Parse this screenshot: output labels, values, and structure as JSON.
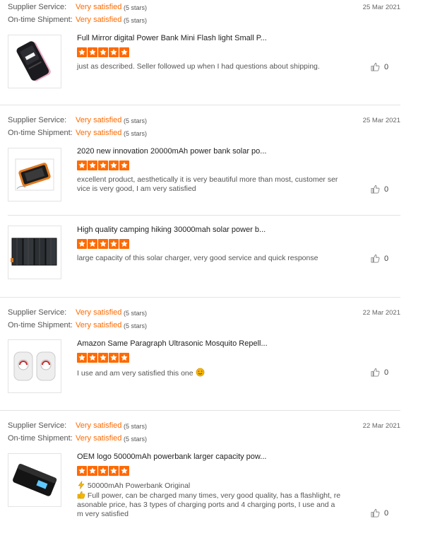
{
  "labels": {
    "supplier_service": "Supplier Service:",
    "ontime_shipment": "On-time Shipment:"
  },
  "colors": {
    "accent": "#ff6a00",
    "divider": "#e3e3e3"
  },
  "reviews": [
    {
      "supplier_value": "Very satisfied",
      "supplier_stars_text": "(5 stars)",
      "shipment_value": "Very satisfied",
      "shipment_stars_text": "(5 stars)",
      "date": "25 Mar 2021",
      "products": [
        {
          "title": "Full Mirror digital Power Bank Mini Flash light Small P...",
          "rating": 5,
          "review": "just as described. Seller followed up when I had questions about shipping.",
          "likes": "0",
          "image": "power-bank-mirror-image"
        }
      ]
    },
    {
      "supplier_value": "Very satisfied",
      "supplier_stars_text": "(5 stars)",
      "shipment_value": "Very satisfied",
      "shipment_stars_text": "(5 stars)",
      "date": "25 Mar 2021",
      "products": [
        {
          "title": "2020 new innovation 20000mAh power bank solar po...",
          "rating": 5,
          "review": "excellent product, aesthetically it is very beautiful more than most, customer service is very good, I am very satisfied",
          "likes": "0",
          "image": "solar-power-bank-image"
        },
        {
          "title": "High quality camping hiking 30000mah solar power b...",
          "rating": 5,
          "review": "large capacity of this solar charger, very good service and quick response",
          "likes": "0",
          "image": "folding-solar-panel-image"
        }
      ]
    },
    {
      "supplier_value": "Very satisfied",
      "supplier_stars_text": "(5 stars)",
      "shipment_value": "Very satisfied",
      "shipment_stars_text": "(5 stars)",
      "date": "22 Mar 2021",
      "products": [
        {
          "title": "Amazon Same Paragraph Ultrasonic Mosquito Repell...",
          "rating": 5,
          "review": "I use and am very satisfied this one",
          "emoji_icon": "smiling-face-hearts-emoji",
          "likes": "0",
          "image": "mosquito-repeller-image"
        }
      ]
    },
    {
      "supplier_value": "Very satisfied",
      "supplier_stars_text": "(5 stars)",
      "shipment_value": "Very satisfied",
      "shipment_stars_text": "(5 stars)",
      "date": "22 Mar 2021",
      "products": [
        {
          "title": "OEM logo 50000mAh powerbank larger capacity pow...",
          "rating": 5,
          "review_line1": "50000mAh Powerbank Original",
          "review_line1_icon": "lightning-emoji",
          "review_body": "Full power, can be charged many times, very good quality, has a flashlight, reasonable price, has 3 types of charging ports and 4 charging ports, I use and am very satisfied",
          "review_body_icon": "thumbs-up-emoji",
          "likes": "0",
          "image": "black-powerbank-image"
        }
      ]
    }
  ]
}
